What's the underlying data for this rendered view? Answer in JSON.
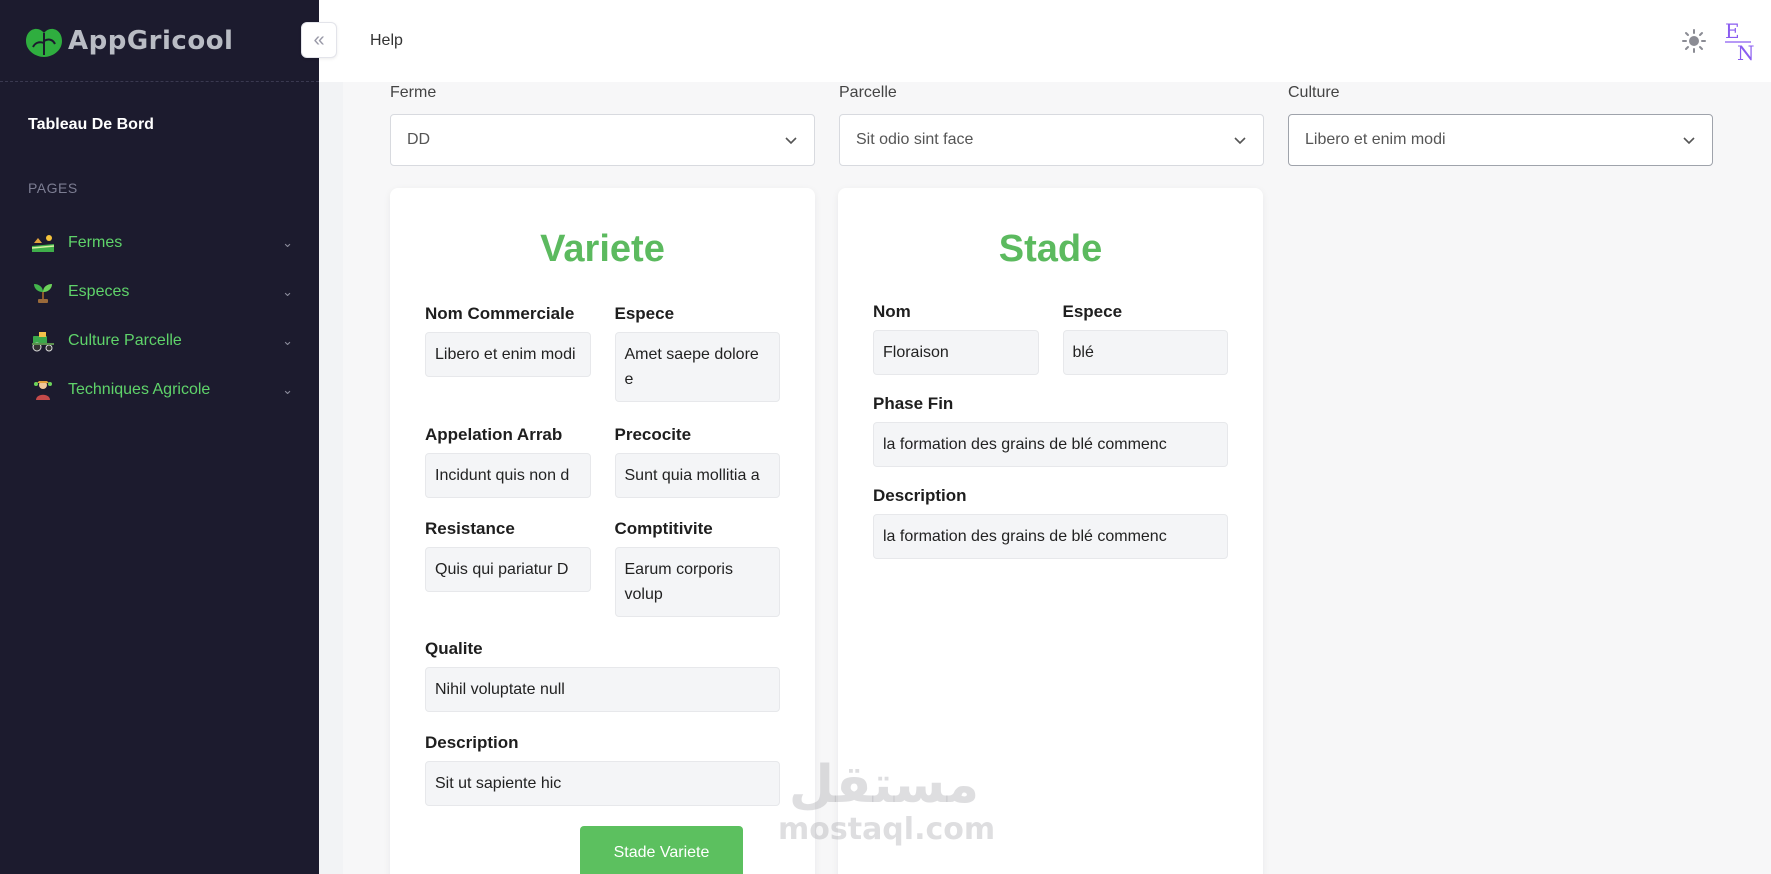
{
  "brand": {
    "name": "AppGricool"
  },
  "sidebar": {
    "dashboard": "Tableau De Bord",
    "section": "PAGES",
    "items": [
      {
        "label": "Fermes",
        "icon": "farm-icon"
      },
      {
        "label": "Especes",
        "icon": "sprout-icon"
      },
      {
        "label": "Culture Parcelle",
        "icon": "tractor-icon"
      },
      {
        "label": "Techniques Agricole",
        "icon": "farmer-icon"
      }
    ]
  },
  "topbar": {
    "help": "Help",
    "lang_top": "E",
    "lang_bottom": "N"
  },
  "filters": {
    "ferme": {
      "label": "Ferme",
      "value": "DD"
    },
    "parcelle": {
      "label": "Parcelle",
      "value": "Sit odio sint face"
    },
    "culture": {
      "label": "Culture",
      "value": "Libero et enim modi"
    }
  },
  "variete": {
    "title": "Variete",
    "nom_commerciale": {
      "label": "Nom Commerciale",
      "value": "Libero et enim modi"
    },
    "espece": {
      "label": "Espece",
      "value": "Amet saepe dolore e"
    },
    "appelation": {
      "label": "Appelation Arrab",
      "value": "Incidunt quis non d"
    },
    "precocite": {
      "label": "Precocite",
      "value": "Sunt quia mollitia a"
    },
    "resistance": {
      "label": "Resistance",
      "value": "Quis qui pariatur D"
    },
    "comptitivite": {
      "label": "Comptitivite",
      "value": "Earum corporis volup"
    },
    "qualite": {
      "label": "Qualite",
      "value": "Nihil voluptate null"
    },
    "description": {
      "label": "Description",
      "value": "Sit ut sapiente hic"
    },
    "button": "Stade Variete"
  },
  "stade": {
    "title": "Stade",
    "nom": {
      "label": "Nom",
      "value": "Floraison"
    },
    "espece": {
      "label": "Espece",
      "value": "blé"
    },
    "phase_fin": {
      "label": "Phase Fin",
      "value": "la formation des grains de blé commenc"
    },
    "description": {
      "label": "Description",
      "value": "la formation des grains de blé commenc"
    }
  },
  "watermark": {
    "arabic": "مستقل",
    "latin": "mostaql.com"
  },
  "colors": {
    "sidebar_bg": "#1c1b2e",
    "accent_green": "#5cba5f",
    "nav_green": "#5fd36a",
    "lang_purple": "#8a5cf0"
  }
}
